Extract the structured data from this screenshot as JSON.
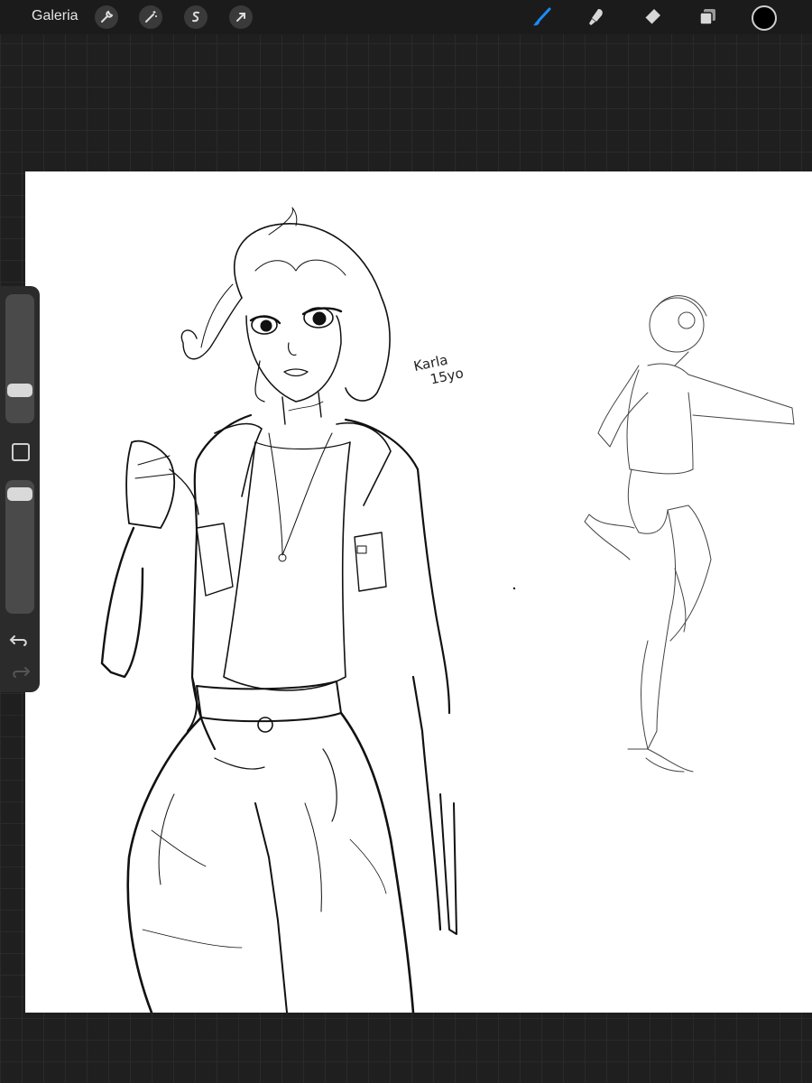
{
  "topbar": {
    "gallery_label": "Galeria",
    "left_tools": [
      "wrench-icon",
      "magic-wand-icon",
      "selection-icon",
      "transform-arrow-icon"
    ],
    "right_tools": [
      "brush-icon",
      "smudge-icon",
      "eraser-icon",
      "layers-icon"
    ],
    "active_tool": "brush",
    "accent_color": "#1a8cff",
    "current_color": "#000000"
  },
  "sidebar": {
    "brush_size_level": 0.22,
    "opacity_level": 0.95,
    "controls": [
      "brush-size-slider",
      "modify-button",
      "opacity-slider",
      "undo-icon",
      "redo-icon"
    ]
  },
  "canvas": {
    "background": "#ffffff",
    "annotation": {
      "name": "Karla",
      "age": "15yo"
    }
  }
}
